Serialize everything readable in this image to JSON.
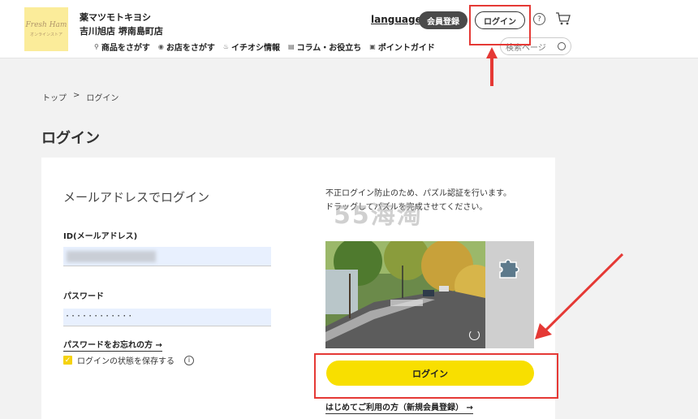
{
  "header": {
    "logo_line1": "Fresh Ham",
    "logo_line2": "オンラインストア",
    "store_line1": "薬マツモトキヨシ",
    "store_line2": "吉川旭店 堺南島町店",
    "language": "language",
    "register": "会員登録",
    "login": "ログイン",
    "help": "?",
    "nav": [
      {
        "icon": "search-icon",
        "label": "商品をさがす"
      },
      {
        "icon": "pin-icon",
        "label": "お店をさがす"
      },
      {
        "icon": "flame-icon",
        "label": "イチオシ情報"
      },
      {
        "icon": "book-icon",
        "label": "コラム・お役立ち"
      },
      {
        "icon": "point-icon",
        "label": "ポイントガイド"
      }
    ],
    "search_placeholder": "検索ページ"
  },
  "breadcrumb": {
    "home": "トップ",
    "sep": ">",
    "current": "ログイン"
  },
  "page_title": "ログイン",
  "form": {
    "section_title": "メールアドレスでログイン",
    "id_label": "ID(メールアドレス)",
    "password_label": "パスワード",
    "password_value": "············",
    "forgot": "パスワードをお忘れの方 →",
    "remember": "ログインの状態を保存する",
    "info": "i"
  },
  "puzzle": {
    "note_line1": "不正ログイン防止のため、パズル認証を行います。",
    "note_line2": "ドラッグしてパズルを完成させてください。",
    "watermark": "55海淘"
  },
  "login_button": "ログイン",
  "first_time": "はじめてご利用の方（新規会員登録） →",
  "colors": {
    "accent": "#f8df00",
    "annotation": "#e53935"
  }
}
